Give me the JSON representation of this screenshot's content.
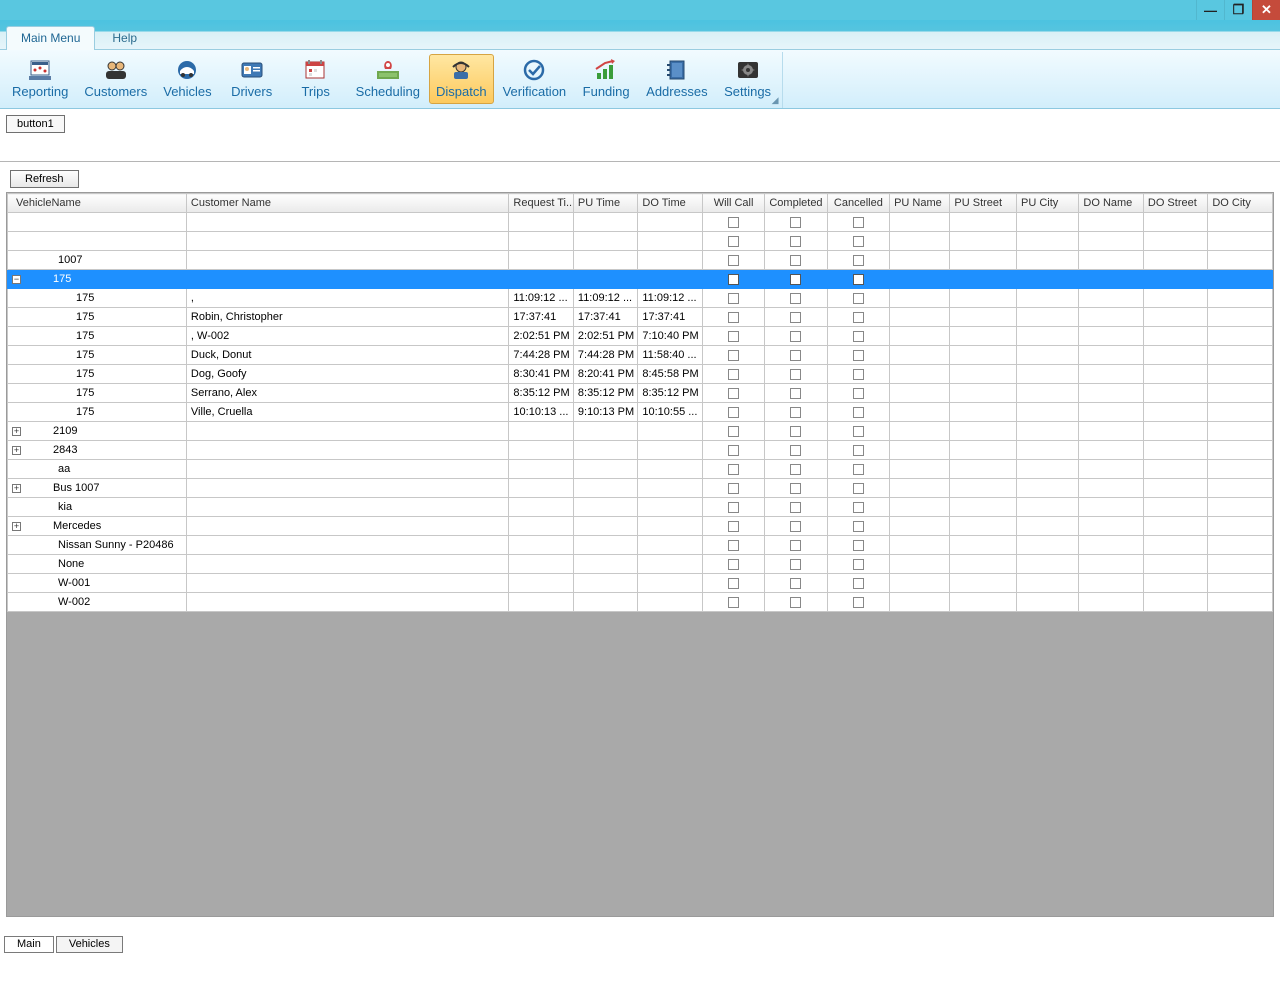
{
  "window": {
    "minimize": "—",
    "maximize": "❐",
    "close": "✕"
  },
  "ribbonTabs": {
    "main": "Main Menu",
    "help": "Help"
  },
  "toolbar": {
    "reporting": "Reporting",
    "customers": "Customers",
    "vehicles": "Vehicles",
    "drivers": "Drivers",
    "trips": "Trips",
    "scheduling": "Scheduling",
    "dispatch": "Dispatch",
    "verification": "Verification",
    "funding": "Funding",
    "addresses": "Addresses",
    "settings": "Settings"
  },
  "buttons": {
    "button1": "button1",
    "refresh": "Refresh"
  },
  "columns": {
    "vehicle": "VehicleName",
    "customer": "Customer Name",
    "request": "Request Ti...",
    "pu": "PU Time",
    "do": "DO Time",
    "will": "Will Call",
    "completed": "Completed",
    "cancelled": "Cancelled",
    "puName": "PU Name",
    "puStreet": "PU Street",
    "puCity": "PU City",
    "doName": "DO Name",
    "doStreet": "DO Street",
    "doCity": "DO City"
  },
  "rows": [
    {
      "vehicle": "",
      "top": true
    },
    {
      "vehicle": "",
      "top": true
    },
    {
      "vehicle": "1007",
      "top": true
    },
    {
      "vehicle": "175",
      "top": true,
      "expander": "-",
      "selected": true
    },
    {
      "vehicle": "175",
      "child": true,
      "customer": ",",
      "req": "11:09:12 ...",
      "pu": "11:09:12 ...",
      "do": "11:09:12 ..."
    },
    {
      "vehicle": "175",
      "child": true,
      "customer": "Robin, Christopher",
      "req": "17:37:41",
      "pu": "17:37:41",
      "do": "17:37:41"
    },
    {
      "vehicle": "175",
      "child": true,
      "customer": ", W-002",
      "req": "2:02:51 PM",
      "pu": "2:02:51 PM",
      "do": "7:10:40 PM"
    },
    {
      "vehicle": "175",
      "child": true,
      "customer": "Duck, Donut",
      "req": "7:44:28 PM",
      "pu": "7:44:28 PM",
      "do": "11:58:40 ..."
    },
    {
      "vehicle": "175",
      "child": true,
      "customer": "Dog, Goofy",
      "req": "8:30:41 PM",
      "pu": "8:20:41 PM",
      "do": "8:45:58 PM"
    },
    {
      "vehicle": "175",
      "child": true,
      "customer": "Serrano, Alex",
      "req": "8:35:12 PM",
      "pu": "8:35:12 PM",
      "do": "8:35:12 PM"
    },
    {
      "vehicle": "175",
      "child": true,
      "customer": "Ville, Cruella",
      "req": "10:10:13 ...",
      "pu": "9:10:13 PM",
      "do": "10:10:55 ..."
    },
    {
      "vehicle": "2109",
      "top": true,
      "expander": "+"
    },
    {
      "vehicle": "2843",
      "top": true,
      "expander": "+"
    },
    {
      "vehicle": "aa",
      "top": true
    },
    {
      "vehicle": "Bus 1007",
      "top": true,
      "expander": "+"
    },
    {
      "vehicle": "kia",
      "top": true
    },
    {
      "vehicle": "Mercedes",
      "top": true,
      "expander": "+"
    },
    {
      "vehicle": "Nissan Sunny - P20486",
      "top": true
    },
    {
      "vehicle": "None",
      "top": true
    },
    {
      "vehicle": "W-001",
      "top": true
    },
    {
      "vehicle": "W-002",
      "top": true
    }
  ],
  "bottomTabs": {
    "main": "Main",
    "vehicles": "Vehicles"
  }
}
